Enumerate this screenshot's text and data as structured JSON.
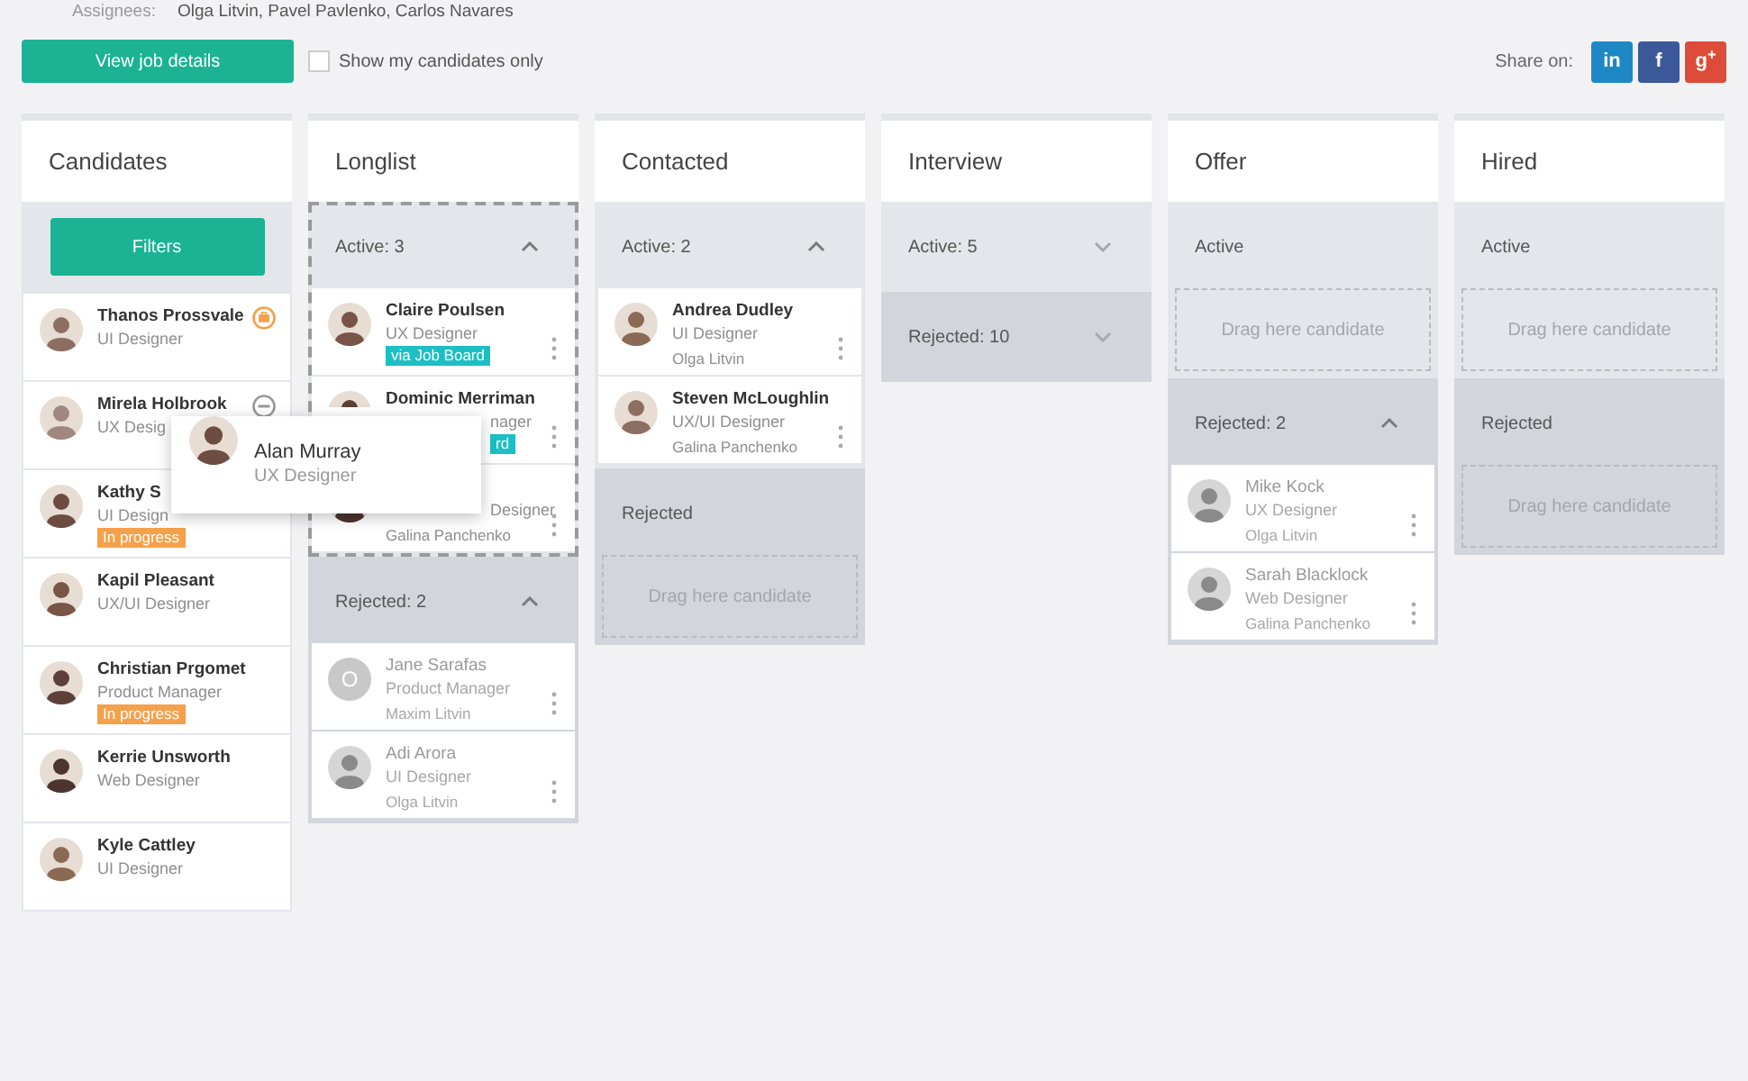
{
  "assignees": {
    "label": "Assignees:",
    "value": "Olga Litvin, Pavel Pavlenko, Carlos Navares"
  },
  "toolbar": {
    "button": "View job details",
    "checkbox": {
      "label": "Show my candidates only",
      "checked": false
    },
    "share_label": "Share on:",
    "share_buttons": [
      {
        "label": "in",
        "color": "#1e88c7"
      },
      {
        "label": "f",
        "color": "#3b5998"
      },
      {
        "label": "g$^{+}$",
        "color": "#dd4b39"
      }
    ]
  },
  "columns": [
    {
      "title": "Candidates",
      "filter_button": "Filters",
      "cards": [
        {
          "name": "Thanos Prossvale",
          "role": "UI Designer",
          "status_icon": {
            "kind": "briefcase"
          }
        },
        {
          "name": "Mirela Holbrook",
          "role": "UX Desig",
          "status_icon": {
            "kind": "minus"
          }
        },
        {
          "name": "Kathy S",
          "role": "UI Design",
          "badge": {
            "text": "In progress",
            "color": "#f5a04a"
          }
        },
        {
          "name": "Kapil Pleasant",
          "role": "UX/UI Designer"
        },
        {
          "name": "Christian Prgomet",
          "role": "Product Manager",
          "badge": {
            "text": "In progress",
            "color": "#f5a04a"
          }
        },
        {
          "name": "Kerrie Unsworth",
          "role": "Web Designer"
        },
        {
          "name": "Kyle Cattley",
          "role": "UI Designer"
        }
      ]
    },
    {
      "title": "Longlist",
      "sections": [
        {
          "label": "Active: 3",
          "kind": "active",
          "expanded": true,
          "highlighted": true,
          "cards": [
            {
              "name": "Claire Poulsen",
              "role": "UX Designer",
              "badge": {
                "text": "via Job Board",
                "color": "#1bbfc4"
              },
              "covered": false,
              "menu": true
            },
            {
              "name": "Dominic Merriman",
              "role": "nager",
              "badge": {
                "text": "rd",
                "color": "#1bbfc4"
              },
              "covered": true,
              "menu": true
            },
            {
              "role": "Designer",
              "owner": "Galina Panchenko",
              "covered": true,
              "menu": true
            }
          ]
        },
        {
          "label": "Rejected: 2",
          "kind": "rejected",
          "expanded": true,
          "highlighted": false,
          "cards": [
            {
              "name": "Jane Sarafas",
              "role": "Product Manager",
              "owner": "Maxim Litvin",
              "initial": "O",
              "faded": true,
              "covered": false,
              "menu": true
            },
            {
              "name": "Adi Arora",
              "role": "UI Designer",
              "owner": "Olga Litvin",
              "faded": true,
              "covered": false,
              "menu": true
            }
          ]
        }
      ]
    },
    {
      "title": "Contacted",
      "sections": [
        {
          "label": "Active: 2",
          "kind": "active",
          "expanded": true,
          "highlighted": false,
          "cards": [
            {
              "name": "Andrea  Dudley",
              "role": "UI Designer",
              "owner": "Olga Litvin",
              "covered": false,
              "menu": true
            },
            {
              "name": "Steven McLoughlin",
              "role": "UX/UI Designer",
              "owner": "Galina Panchenko",
              "covered": false,
              "menu": true
            }
          ]
        },
        {
          "label": "Rejected",
          "kind": "rejected",
          "highlighted": false,
          "drop_hint": "Drag here candidate"
        }
      ]
    },
    {
      "title": "Interview",
      "sections": [
        {
          "label": "Active: 5",
          "kind": "active",
          "expanded": false,
          "highlighted": false
        },
        {
          "label": "Rejected: 10",
          "kind": "rejected",
          "expanded": false,
          "highlighted": false
        }
      ]
    },
    {
      "title": "Offer",
      "sections": [
        {
          "label": "Active",
          "kind": "active",
          "highlighted": false,
          "drop_hint": "Drag here candidate"
        },
        {
          "label": "Rejected: 2",
          "kind": "rejected",
          "expanded": true,
          "highlighted": false,
          "cards": [
            {
              "name": "Mike  Kock",
              "role": "UX Designer",
              "owner": "Olga Litvin",
              "faded": true,
              "covered": false,
              "menu": true
            },
            {
              "name": "Sarah Blacklock",
              "role": "Web Designer",
              "owner": "Galina Panchenko",
              "faded": true,
              "covered": false,
              "menu": true
            }
          ]
        }
      ]
    },
    {
      "title": "Hired",
      "sections": [
        {
          "label": "Active",
          "kind": "active",
          "highlighted": false,
          "drop_hint": "Drag here candidate"
        },
        {
          "label": "Rejected",
          "kind": "rejected",
          "highlighted": false,
          "drop_hint": "Drag here candidate"
        }
      ]
    }
  ],
  "drag_card": {
    "name": "Alan Murray",
    "role": "UX Designer"
  }
}
